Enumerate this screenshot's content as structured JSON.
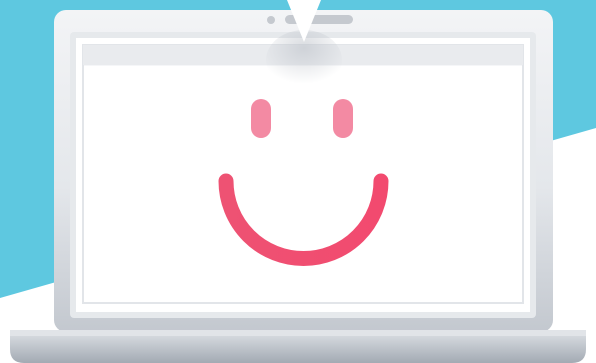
{
  "scene": {
    "description_icon": "laptop-smiley-illustration",
    "colors": {
      "background_blue": "#5ec8e0",
      "background_white": "#ffffff",
      "laptop_bezel_light": "#eef0f3",
      "laptop_bezel_shadow": "#c7ccd3",
      "screen_frame": "#e3e6ea",
      "screen_header": "#e9ebee",
      "screen_body": "#ffffff",
      "camera_dot": "#c5c9cf",
      "base_top": "#d4d8de",
      "base_bottom": "#9fa6af",
      "smile": "#ef4f74",
      "eyes": "#f38aa3"
    },
    "icons": {
      "pointer": "pointer-triangle-icon",
      "face": "smiley-face-icon",
      "camera": "webcam-icon"
    }
  }
}
